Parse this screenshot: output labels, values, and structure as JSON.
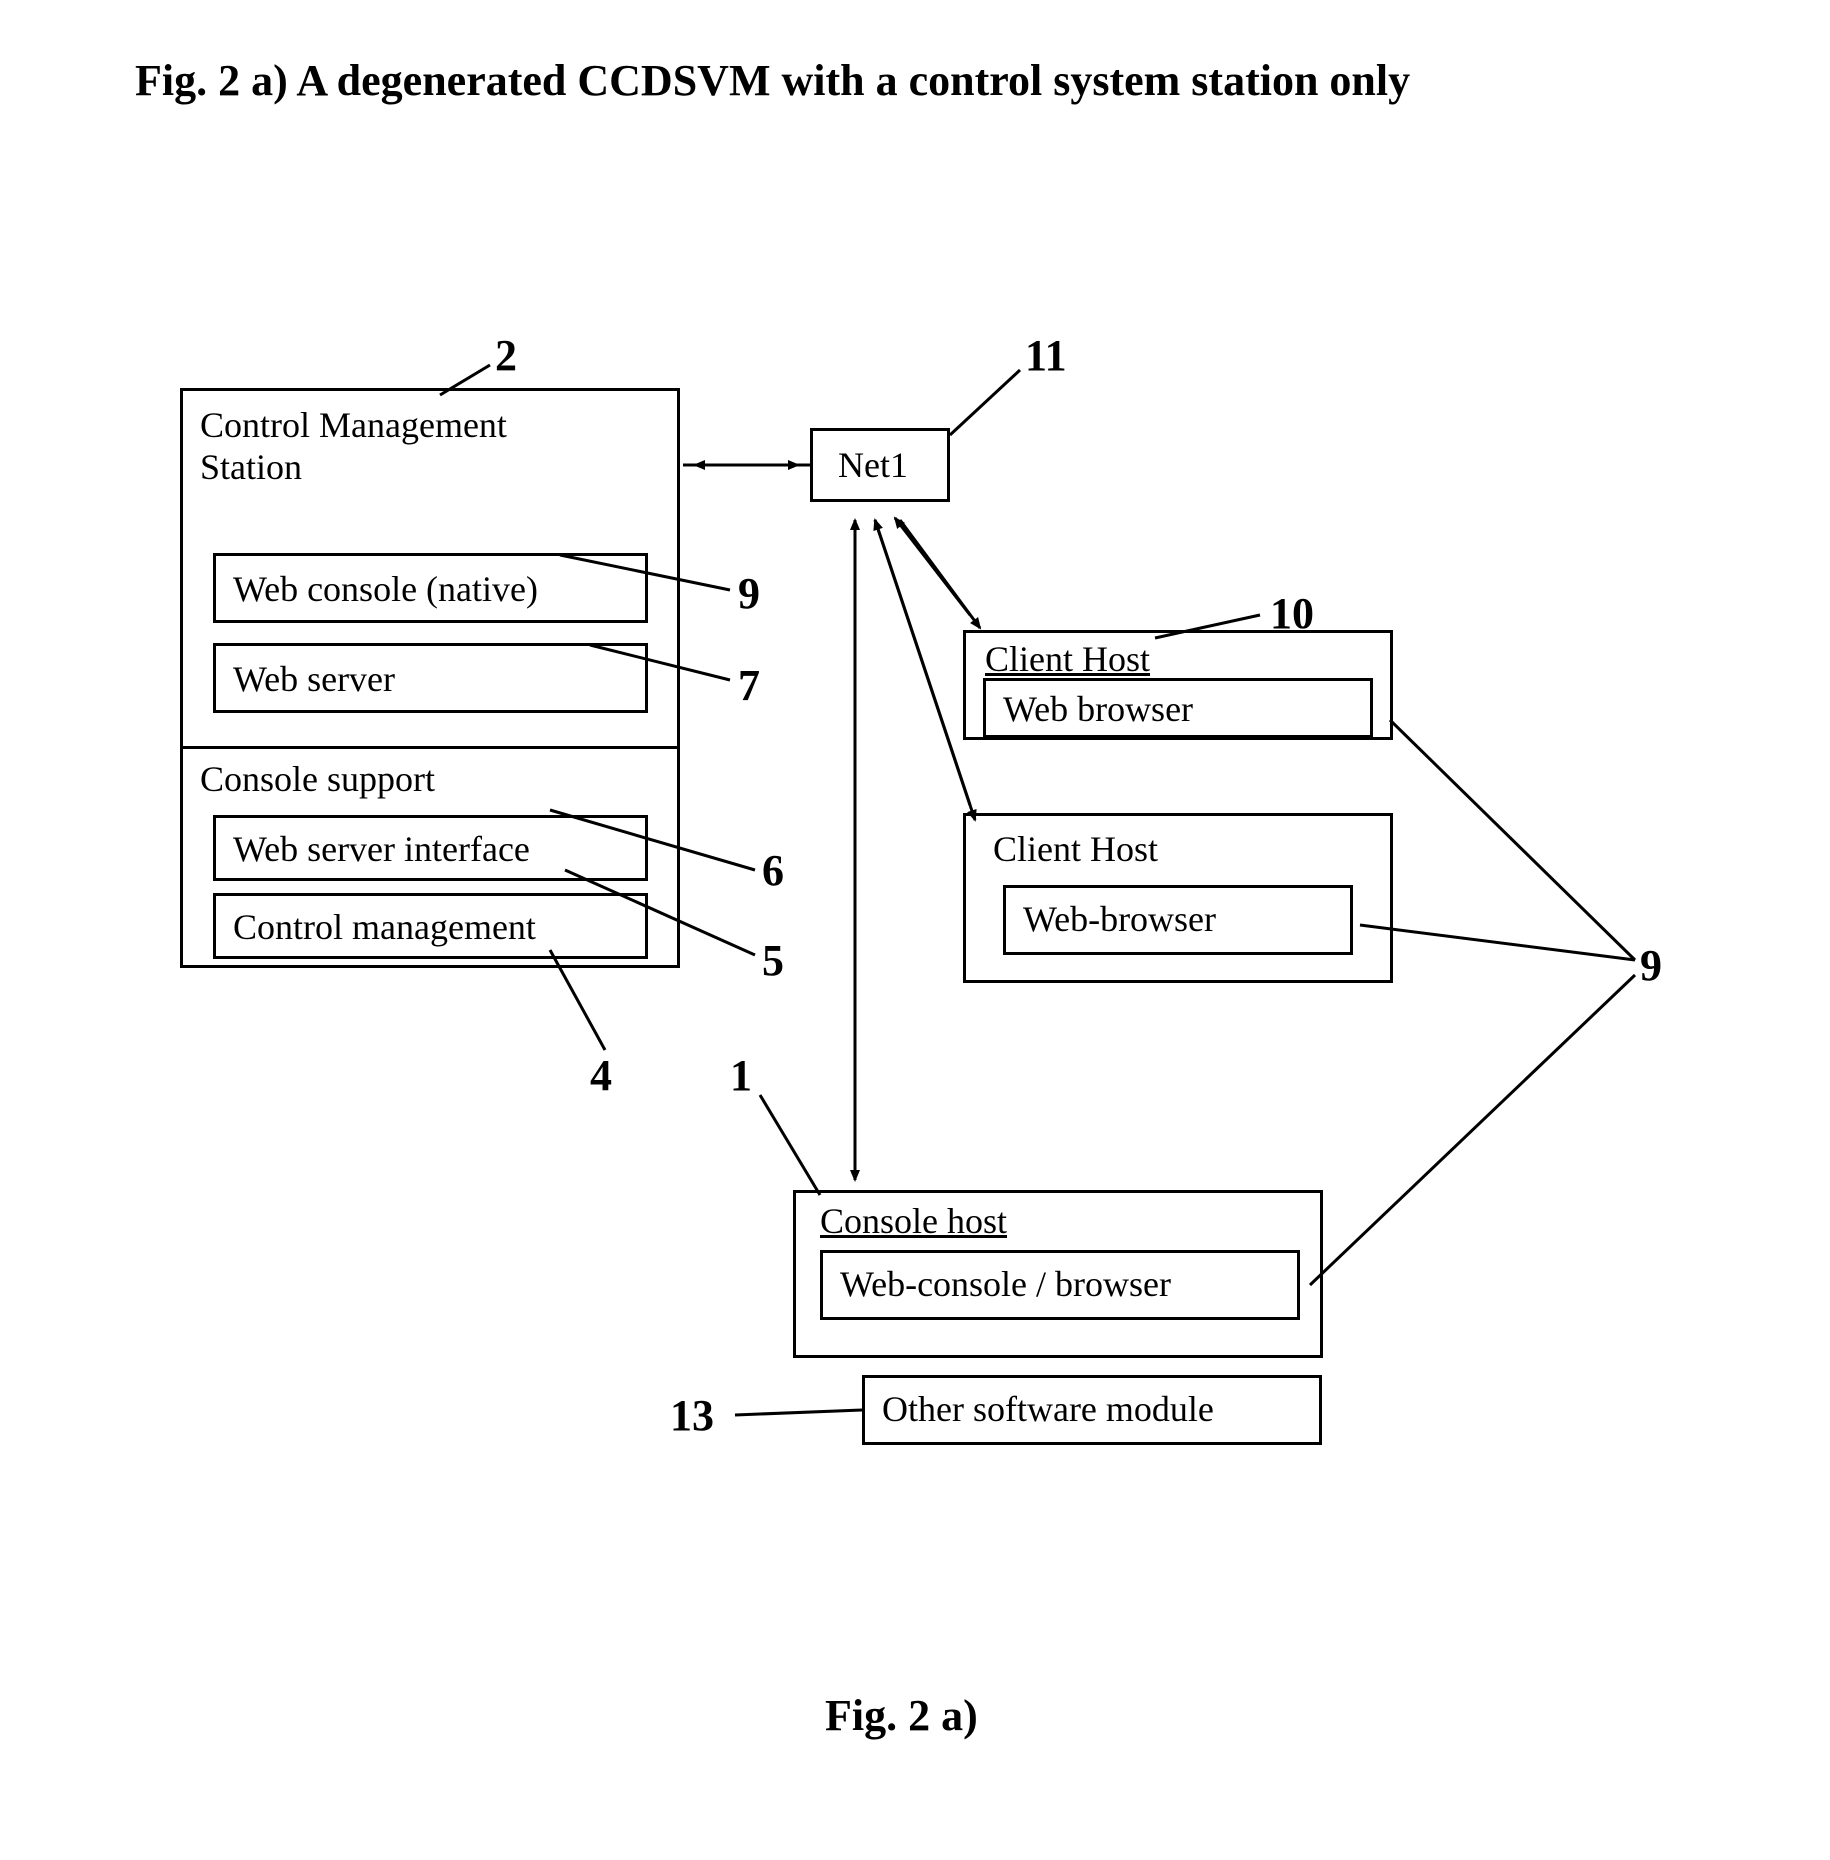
{
  "title": "Fig. 2  a) A degenerated CCDSVM with a control system station only",
  "footer": "Fig. 2 a)",
  "cms": {
    "title_line1": "Control Management",
    "title_line2": "Station",
    "web_console": "Web console (native)",
    "web_server": "Web server",
    "console_support": "Console support",
    "web_server_interface": "Web server interface",
    "control_management": "Control management"
  },
  "net1": "Net1",
  "client1": {
    "title": "Client Host",
    "browser": "Web browser"
  },
  "client2": {
    "title": "Client Host",
    "browser": "Web-browser"
  },
  "console_host": {
    "title": "Console host",
    "browser": "Web-console / browser",
    "other": "Other software module"
  },
  "refs": {
    "r2": "2",
    "r11": "11",
    "r9a": "9",
    "r7": "7",
    "r6": "6",
    "r5": "5",
    "r4": "4",
    "r1": "1",
    "r10": "10",
    "r9b": "9",
    "r13": "13"
  }
}
